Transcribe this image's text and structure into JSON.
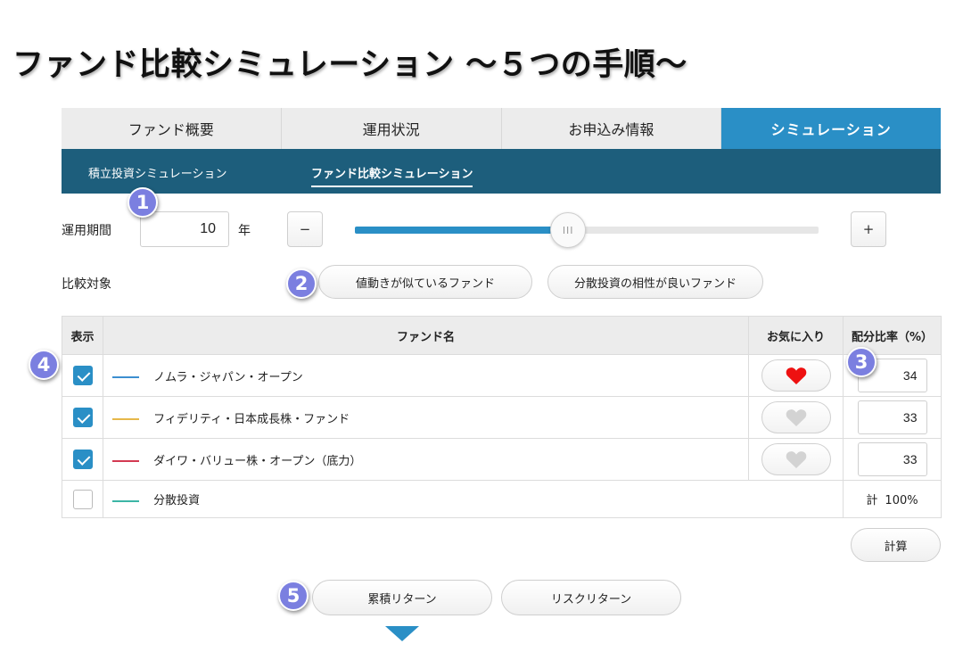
{
  "page": {
    "title": "ファンド比較シミュレーション 〜５つの手順〜"
  },
  "tabs": [
    {
      "label": "ファンド概要",
      "active": false
    },
    {
      "label": "運用状況",
      "active": false
    },
    {
      "label": "お申込み情報",
      "active": false
    },
    {
      "label": "シミュレーション",
      "active": true
    }
  ],
  "subtabs": [
    {
      "label": "積立投資シミュレーション",
      "active": false
    },
    {
      "label": "ファンド比較シミュレーション",
      "active": true
    }
  ],
  "badges": [
    "1",
    "2",
    "3",
    "4",
    "5"
  ],
  "period": {
    "label": "運用期間",
    "value": "10",
    "unit": "年",
    "minus_label": "−",
    "plus_label": "+",
    "slider_fraction": 0.46,
    "thumb_grip": "III"
  },
  "compare": {
    "label": "比較対象",
    "options": [
      "値動きが似ているファンド",
      "分散投資の相性が良いファンド"
    ]
  },
  "table": {
    "headers": {
      "show": "表示",
      "name": "ファンド名",
      "favorite": "お気に入り",
      "ratio": "配分比率（%）"
    },
    "rows": [
      {
        "checked": true,
        "color": "#3d8fd0",
        "name": "ノムラ・ジャパン・オープン",
        "favorite": true,
        "ratio": "34"
      },
      {
        "checked": true,
        "color": "#e6b84a",
        "name": "フィデリティ・日本成長株・ファンド",
        "favorite": false,
        "ratio": "33"
      },
      {
        "checked": true,
        "color": "#d33a52",
        "name": "ダイワ・バリュー株・オープン（底力）",
        "favorite": false,
        "ratio": "33"
      }
    ],
    "total_row": {
      "checked": false,
      "color": "#3cb5a6",
      "name": "分散投資",
      "total_label": "計",
      "total_value": "100%"
    }
  },
  "colors": {
    "accent": "#2a8fc6",
    "subnav": "#1d5e7c",
    "badge": "#7b7fe0",
    "heart_on": "#ee1111",
    "heart_off": "#d3d3d3"
  },
  "calc_label": "計算",
  "bottom": {
    "cumulative_label": "累積リターン",
    "risk_label": "リスクリターン"
  }
}
